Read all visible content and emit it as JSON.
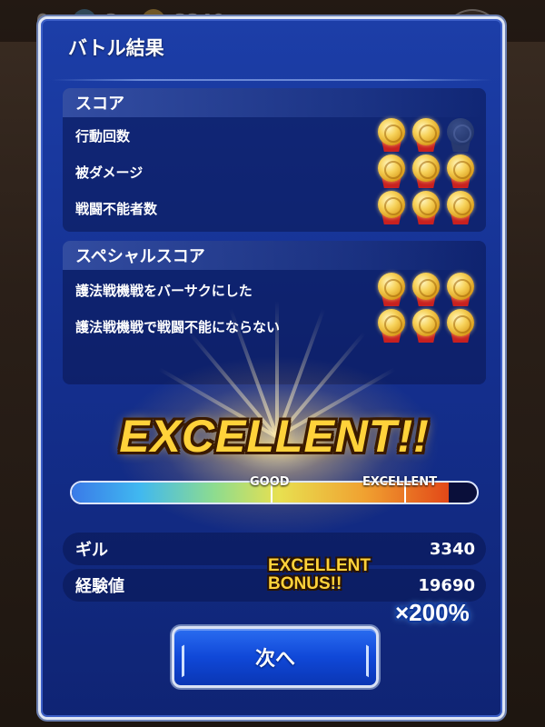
{
  "hud": {
    "values": [
      "0",
      "3",
      "3340"
    ]
  },
  "dialog": {
    "title": "バトル結果"
  },
  "score": {
    "header": "スコア",
    "rows": [
      {
        "label": "行動回数",
        "medals": [
          true,
          true,
          false
        ]
      },
      {
        "label": "被ダメージ",
        "medals": [
          true,
          true,
          true
        ]
      },
      {
        "label": "戦闘不能者数",
        "medals": [
          true,
          true,
          true
        ]
      }
    ]
  },
  "special": {
    "header": "スペシャルスコア",
    "rows": [
      {
        "label": "護法戦機戦をバーサクにした",
        "medals": [
          true,
          true,
          true
        ]
      },
      {
        "label": "護法戦機戦で戦闘不能にならない",
        "medals": [
          true,
          true,
          true
        ]
      }
    ]
  },
  "rank": {
    "text": "EXCELLENT!!",
    "gauge_fill_percent": 93,
    "good_label": "GOOD",
    "excellent_label": "EXCELLENT"
  },
  "stats": {
    "gil_label": "ギル",
    "gil_value": "3340",
    "exp_label": "経験値",
    "exp_value": "19690"
  },
  "bonus": {
    "line1": "EXCELLENT",
    "line2": "BONUS!!",
    "multiplier": "×200%"
  },
  "next_button": {
    "label": "次へ"
  },
  "colors": {
    "dialog_blue": "#1c3ea8",
    "gold": "#ffd23a",
    "ribbon_red": "#c82020"
  }
}
